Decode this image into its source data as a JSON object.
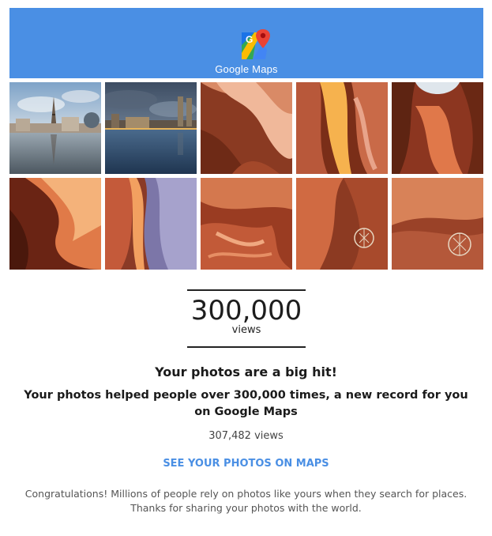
{
  "header": {
    "brand_icon": "google-maps-pin-icon",
    "brand_text": "Google Maps",
    "bg_color": "#4a8fe4"
  },
  "photo_grid": {
    "tiles": [
      {
        "name": "las-vegas-paris-photo"
      },
      {
        "name": "lake-city-skyline-photo"
      },
      {
        "name": "antelope-canyon-photo-1"
      },
      {
        "name": "antelope-canyon-photo-2"
      },
      {
        "name": "antelope-canyon-photo-3"
      },
      {
        "name": "antelope-canyon-photo-4"
      },
      {
        "name": "antelope-canyon-photo-5"
      },
      {
        "name": "antelope-canyon-photo-6"
      },
      {
        "name": "antelope-canyon-photo-7"
      },
      {
        "name": "antelope-canyon-photo-8"
      }
    ]
  },
  "stat": {
    "number": "300,000",
    "unit": "views"
  },
  "headline": "Your photos are a big hit!",
  "subline": "Your photos helped people over 300,000 times, a new record for you on Google Maps",
  "view_count": "307,482 views",
  "cta_label": "SEE YOUR PHOTOS ON MAPS",
  "congrats": "Congratulations! Millions of people rely on photos like yours when they search for places. Thanks for sharing your photos with the world.",
  "accent_color": "#4a8fe4"
}
